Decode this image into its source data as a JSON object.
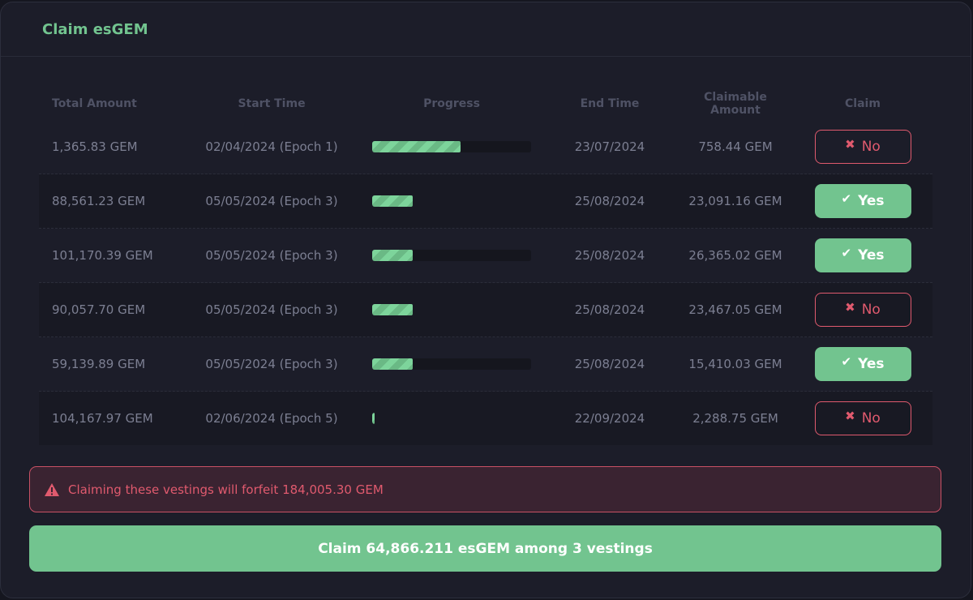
{
  "panel": {
    "title": "Claim esGEM"
  },
  "table": {
    "headers": {
      "total_amount": "Total Amount",
      "start_time": "Start Time",
      "progress": "Progress",
      "end_time": "End Time",
      "claimable_amount": "Claimable Amount",
      "claim": "Claim"
    },
    "rows": [
      {
        "total": "1,365.83 GEM",
        "start": "02/04/2024 (Epoch 1)",
        "progress": 0.56,
        "end": "23/07/2024",
        "claimable": "758.44 GEM",
        "claim_label": "No",
        "claim_state": "no"
      },
      {
        "total": "88,561.23 GEM",
        "start": "05/05/2024 (Epoch 3)",
        "progress": 0.26,
        "end": "25/08/2024",
        "claimable": "23,091.16 GEM",
        "claim_label": "Yes",
        "claim_state": "yes"
      },
      {
        "total": "101,170.39 GEM",
        "start": "05/05/2024 (Epoch 3)",
        "progress": 0.26,
        "end": "25/08/2024",
        "claimable": "26,365.02 GEM",
        "claim_label": "Yes",
        "claim_state": "yes"
      },
      {
        "total": "90,057.70 GEM",
        "start": "05/05/2024 (Epoch 3)",
        "progress": 0.26,
        "end": "25/08/2024",
        "claimable": "23,467.05 GEM",
        "claim_label": "No",
        "claim_state": "no"
      },
      {
        "total": "59,139.89 GEM",
        "start": "05/05/2024 (Epoch 3)",
        "progress": 0.26,
        "end": "25/08/2024",
        "claimable": "15,410.03 GEM",
        "claim_label": "Yes",
        "claim_state": "yes"
      },
      {
        "total": "104,167.97 GEM",
        "start": "02/06/2024 (Epoch 5)",
        "progress": 0.02,
        "end": "22/09/2024",
        "claimable": "2,288.75 GEM",
        "claim_label": "No",
        "claim_state": "no"
      }
    ]
  },
  "warning": {
    "text": "Claiming these vestings will forfeit 184,005.30 GEM",
    "icon": "warning-triangle-icon"
  },
  "claim_all": {
    "label": "Claim 64,866.211 esGEM among 3 vestings"
  },
  "colors": {
    "accent": "#72c48f",
    "danger": "#e05a6e",
    "background": "#1c1d29"
  }
}
